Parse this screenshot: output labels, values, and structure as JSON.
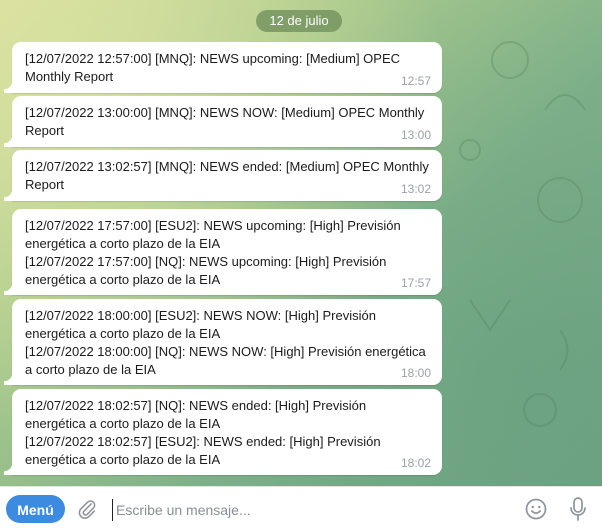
{
  "date_separator": "12 de julio",
  "messages": [
    {
      "lines": [
        "[12/07/2022 12:57:00] [MNQ]: NEWS upcoming: [Medium] OPEC Monthly Report"
      ],
      "time": "12:57"
    },
    {
      "lines": [
        "[12/07/2022 13:00:00] [MNQ]: NEWS NOW: [Medium] OPEC Monthly Report"
      ],
      "time": "13:00"
    },
    {
      "lines": [
        "[12/07/2022 13:02:57] [MNQ]: NEWS ended: [Medium] OPEC Monthly Report"
      ],
      "time": "13:02"
    },
    {
      "lines": [
        "[12/07/2022 17:57:00] [ESU2]: NEWS upcoming: [High] Previsión energética a corto plazo de la EIA",
        "[12/07/2022 17:57:00] [NQ]: NEWS upcoming: [High] Previsión energética a corto plazo de la EIA"
      ],
      "time": "17:57"
    },
    {
      "lines": [
        "[12/07/2022 18:00:00] [ESU2]: NEWS NOW: [High] Previsión energética a corto plazo de la EIA",
        "[12/07/2022 18:00:00] [NQ]: NEWS NOW: [High] Previsión energética a corto plazo de la EIA"
      ],
      "time": "18:00"
    },
    {
      "lines": [
        "[12/07/2022 18:02:57] [NQ]: NEWS ended: [High] Previsión energética a corto plazo de la EIA",
        "[12/07/2022 18:02:57] [ESU2]: NEWS ended: [High] Previsión energética a corto plazo de la EIA"
      ],
      "time": "18:02"
    }
  ],
  "input_bar": {
    "menu_label": "Menú",
    "placeholder": "Escribe un mensaje...",
    "icons": [
      "paperclip-icon",
      "emoji-icon",
      "microphone-icon"
    ]
  },
  "colors": {
    "menu_button": "#3d8be0",
    "date_pill": "#6e8c5a",
    "bubble": "#ffffff",
    "time_text": "#9aa3a9"
  }
}
